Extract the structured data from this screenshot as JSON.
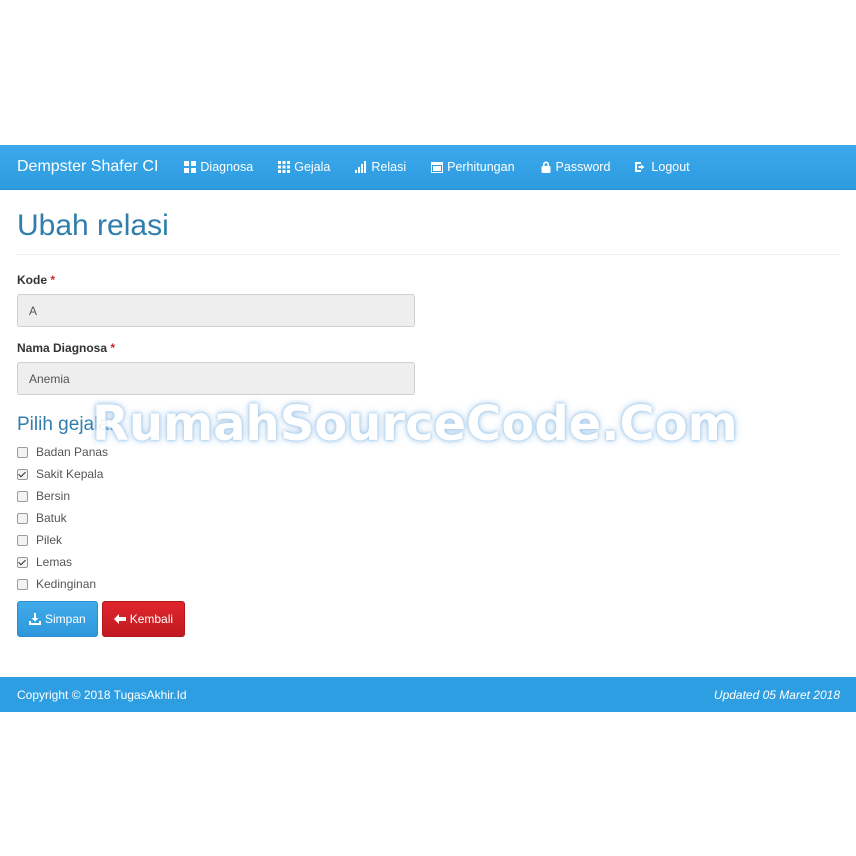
{
  "navbar": {
    "brand": "Dempster Shafer CI",
    "items": [
      {
        "label": "Diagnosa",
        "icon": "th-large-icon"
      },
      {
        "label": "Gejala",
        "icon": "th-icon"
      },
      {
        "label": "Relasi",
        "icon": "signal-icon"
      },
      {
        "label": "Perhitungan",
        "icon": "calendar-icon"
      },
      {
        "label": "Password",
        "icon": "lock-icon"
      },
      {
        "label": "Logout",
        "icon": "logout-icon"
      }
    ]
  },
  "page": {
    "title": "Ubah relasi"
  },
  "form": {
    "kode_label": "Kode",
    "kode_value": "A",
    "nama_label": "Nama Diagnosa",
    "nama_value": "Anemia",
    "required_mark": "*",
    "gejala_title": "Pilih gejala:",
    "gejala": [
      {
        "label": "Badan Panas",
        "checked": false
      },
      {
        "label": "Sakit Kepala",
        "checked": true
      },
      {
        "label": "Bersin",
        "checked": false
      },
      {
        "label": "Batuk",
        "checked": false
      },
      {
        "label": "Pilek",
        "checked": false
      },
      {
        "label": "Lemas",
        "checked": true
      },
      {
        "label": "Kedinginan",
        "checked": false
      }
    ],
    "save_label": "Simpan",
    "back_label": "Kembali"
  },
  "footer": {
    "copyright": "Copyright © 2018 TugasAkhir.Id",
    "updated": "Updated 05 Maret 2018"
  },
  "watermark": "RumahSourceCode.Com",
  "colors": {
    "navbar": "#2e9ee2",
    "title": "#317eac",
    "primary": "#2d98dc",
    "danger": "#c01a20"
  }
}
